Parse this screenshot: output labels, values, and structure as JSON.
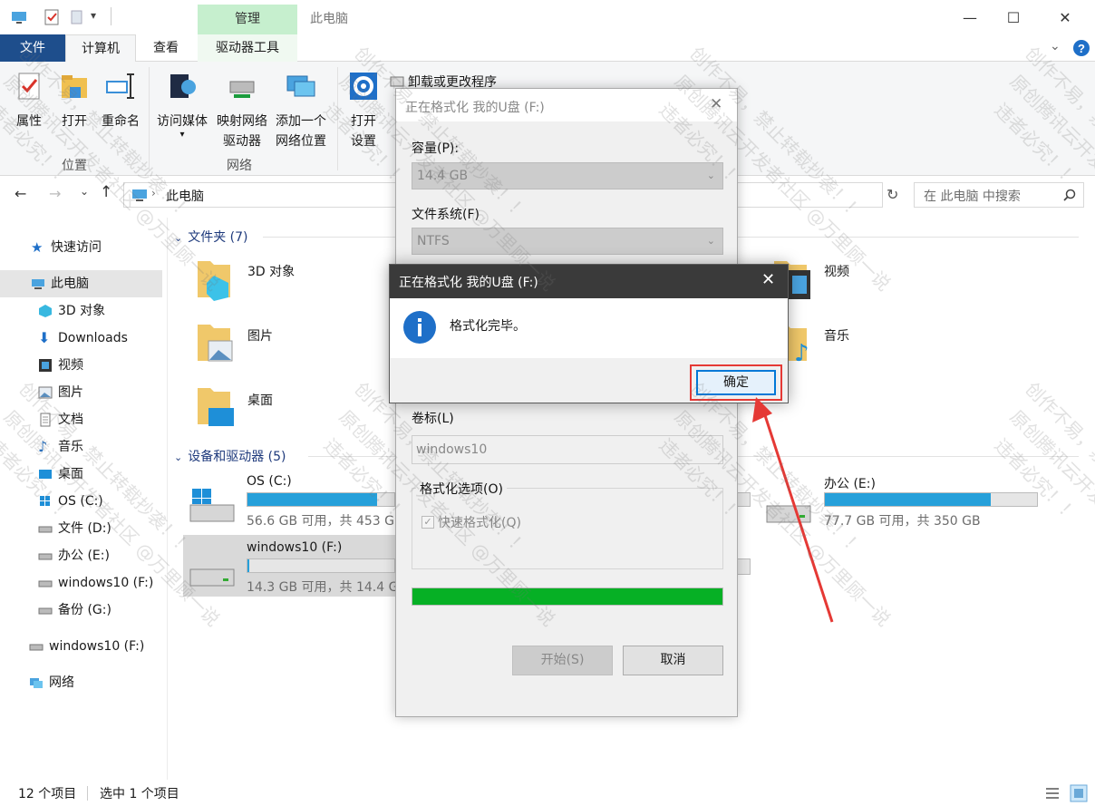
{
  "titlebar": {
    "manage_tab": "管理",
    "window_title": "此电脑",
    "minimize": "—",
    "maximize": "☐",
    "close": "✕"
  },
  "ribbon_tabs": [
    "文件",
    "计算机",
    "查看",
    "驱动器工具"
  ],
  "ribbon": {
    "properties": "属性",
    "open": "打开",
    "rename": "重命名",
    "group_location": "位置",
    "access_media": "访问媒体",
    "map_drive_line1": "映射网络",
    "map_drive_line2": "驱动器",
    "add_location_line1": "添加一个",
    "add_location_line2": "网络位置",
    "group_network": "网络",
    "open_settings_line1": "打开",
    "open_settings_line2": "设置",
    "uninstall": "卸载或更改程序"
  },
  "address": {
    "path": "此电脑",
    "search_placeholder": "在 此电脑 中搜索"
  },
  "nav": {
    "quick_access": "快速访问",
    "this_pc": "此电脑",
    "items": [
      "3D 对象",
      "Downloads",
      "视频",
      "图片",
      "文档",
      "音乐",
      "桌面",
      "OS (C:)",
      "文件 (D:)",
      "办公 (E:)",
      "windows10 (F:)",
      "备份 (G:)"
    ],
    "usb": "windows10 (F:)",
    "network": "网络"
  },
  "content": {
    "folders_header": "文件夹 (7)",
    "folders": [
      "3D 对象",
      "视频",
      "图片",
      "音乐",
      "桌面"
    ],
    "drives_header": "设备和驱动器 (5)",
    "drive_c": {
      "name": "OS (C:)",
      "cap": "56.6 GB 可用，共 453 G",
      "fill": 0.88
    },
    "drive_e": {
      "name": "办公 (E:)",
      "cap": "77.7 GB 可用，共 350 GB",
      "fill": 0.78
    },
    "drive_f": {
      "name": "windows10 (F:)",
      "cap": "14.3 GB 可用，共 14.4 G",
      "fill": 0.01
    }
  },
  "status": {
    "count": "12 个项目",
    "selected": "选中 1 个项目"
  },
  "format_dialog": {
    "title": "正在格式化 我的U盘 (F:)",
    "capacity_label": "容量(P):",
    "capacity_value": "14.4 GB",
    "fs_label": "文件系统(F)",
    "fs_value": "NTFS",
    "volume_label": "卷标(L)",
    "volume_value": "windows10",
    "options_label": "格式化选项(O)",
    "quick_format": "快速格式化(Q)",
    "progress": 1.0,
    "start_button": "开始(S)",
    "cancel_button": "取消"
  },
  "message_box": {
    "title": "正在格式化 我的U盘 (F:)",
    "message": "格式化完毕。",
    "ok_button": "确定"
  },
  "watermark": {
    "line1": "创作不易，禁止转载抄袭！！",
    "line2": "原创腾讯云开发者社区 @万里顾一说",
    "line3": "违者必究！！"
  },
  "colors": {
    "accent": "#0078d7",
    "drive_fill": "#26a0da",
    "progress": "#06b025",
    "highlight": "#e53935"
  }
}
